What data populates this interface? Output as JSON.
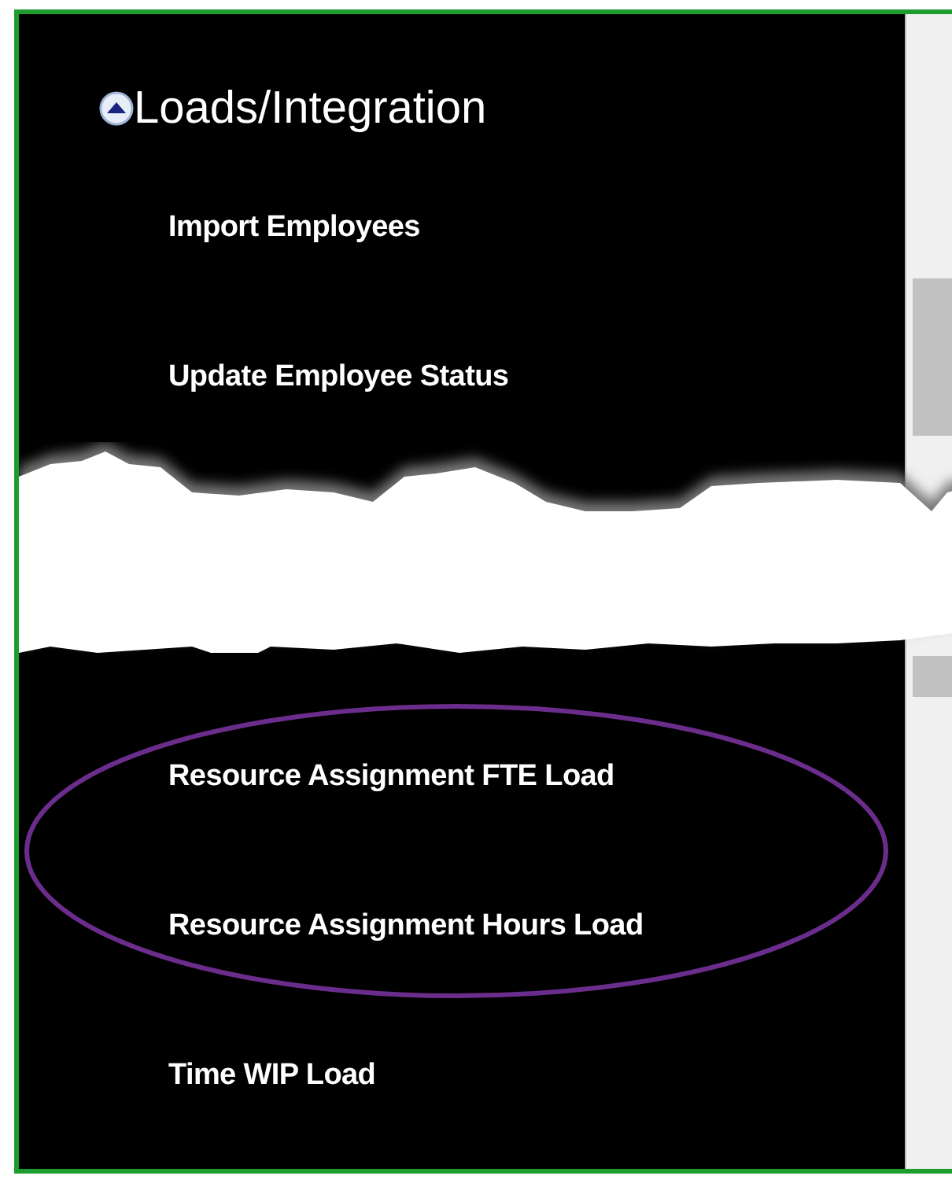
{
  "section": {
    "title": "Loads/Integration",
    "expanded": true
  },
  "items_above_tear": [
    {
      "label": "Import Employees"
    },
    {
      "label": "Update Employee Status"
    }
  ],
  "circled_items": [
    {
      "label": "Resource Assignment FTE Load"
    },
    {
      "label": "Resource Assignment Hours Load"
    }
  ],
  "items_below": [
    {
      "label": "Time WIP Load"
    }
  ]
}
